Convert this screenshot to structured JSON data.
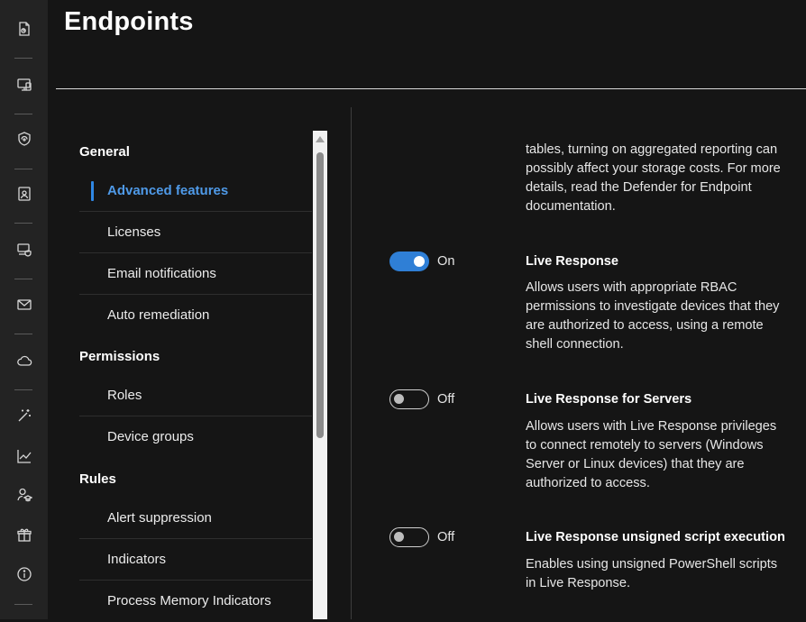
{
  "header": {
    "title": "Endpoints"
  },
  "rail": {
    "icons": [
      "reports-icon",
      "devices-icon",
      "shield-icon",
      "identity-card-icon",
      "device-shield-icon",
      "mail-icon",
      "cloud-icon",
      "wand-icon",
      "chart-icon",
      "user-learning-icon",
      "gift-icon",
      "info-icon"
    ]
  },
  "nav": {
    "general_heading": "General",
    "general_items": [
      {
        "label": "Advanced features",
        "active": true
      },
      {
        "label": "Licenses"
      },
      {
        "label": "Email notifications"
      },
      {
        "label": "Auto remediation"
      }
    ],
    "permissions_heading": "Permissions",
    "permissions_items": [
      {
        "label": "Roles"
      },
      {
        "label": "Device groups"
      }
    ],
    "rules_heading": "Rules",
    "rules_items": [
      {
        "label": "Alert suppression"
      },
      {
        "label": "Indicators"
      },
      {
        "label": "Process Memory Indicators"
      }
    ]
  },
  "content": {
    "top_description": [
      "tables, turning on aggregated reporting can",
      "possibly affect your storage costs. For more",
      "details, read the Defender for Endpoint",
      "documentation."
    ],
    "features": [
      {
        "toggle_state": "On",
        "is_on": true,
        "title": "Live Response",
        "description": [
          "Allows users with appropriate RBAC",
          "permissions to investigate devices that they",
          "are authorized to access, using a remote",
          "shell connection."
        ]
      },
      {
        "toggle_state": "Off",
        "is_on": false,
        "title": "Live Response for Servers",
        "description": [
          "Allows users with Live Response privileges",
          "to connect remotely to servers (Windows",
          "Server or Linux devices) that they are",
          "authorized to access."
        ]
      },
      {
        "toggle_state": "Off",
        "is_on": false,
        "title": "Live Response unsigned script execution",
        "description": [
          "Enables using unsigned PowerShell scripts",
          "in Live Response."
        ]
      }
    ]
  },
  "colors": {
    "accent": "#2f87e4",
    "background": "#151515",
    "rail": "#232323"
  }
}
